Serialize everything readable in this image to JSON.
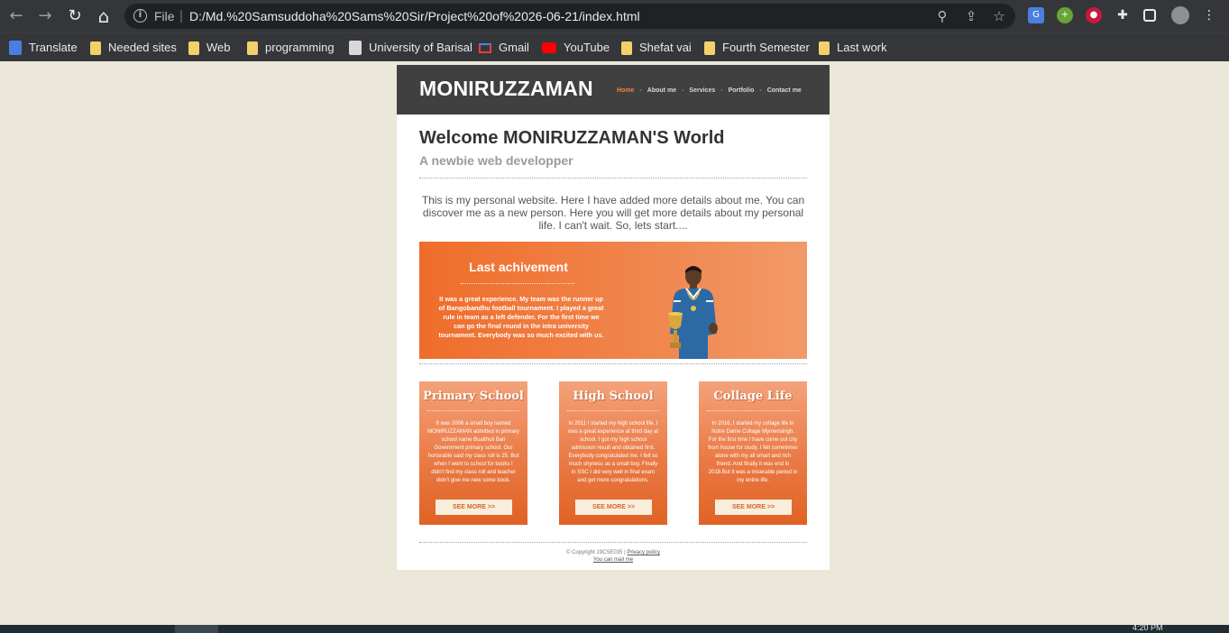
{
  "browser": {
    "nav": {
      "back": "←",
      "forward": "→",
      "reload": "↻",
      "home": "⌂"
    },
    "omnibox": {
      "scheme": "File",
      "separator": "|",
      "url": "D:/Md.%20Samsuddoha%20Sams%20Sir/Project%20of%2026-06-21/index.html"
    },
    "icons": [
      "zoom-icon",
      "share-icon",
      "bookmark-star-icon"
    ],
    "extensions": [
      "google-translate-extension-icon",
      "green-extension-icon",
      "red-extension-icon",
      "puzzle-extensions-icon",
      "side-panel-icon",
      "profile-avatar",
      "kebab-menu-icon"
    ],
    "bookmarks": [
      {
        "label": "Translate",
        "icon": "translate-icon"
      },
      {
        "label": "Needed sites",
        "icon": "folder-icon"
      },
      {
        "label": "Web",
        "icon": "folder-icon"
      },
      {
        "label": "programming",
        "icon": "folder-icon"
      },
      {
        "label": "University of Barisal",
        "icon": "university-icon"
      },
      {
        "label": "Gmail",
        "icon": "gmail-icon"
      },
      {
        "label": "YouTube",
        "icon": "youtube-icon"
      },
      {
        "label": "Shefat vai",
        "icon": "folder-icon"
      },
      {
        "label": "Fourth Semester",
        "icon": "folder-icon"
      },
      {
        "label": "Last work",
        "icon": "folder-icon"
      }
    ]
  },
  "site": {
    "logo": "MONIRUZZAMAN",
    "menu": [
      {
        "label": "Home",
        "active": true
      },
      {
        "label": "About me",
        "active": false
      },
      {
        "label": "Services",
        "active": false
      },
      {
        "label": "Portfolio",
        "active": false
      },
      {
        "label": "Contact me",
        "active": false
      }
    ],
    "menu_separator": "-",
    "welcome": "Welcome MONIRUZZAMAN'S World",
    "subtitle": "A newbie web developper",
    "intro": "This is my personal website. Here I have added more details about me. You can discover me as a new person. Here you will get more details about my personal life. I can't wait. So, lets start....",
    "banner": {
      "title": "Last achivement",
      "text": "It was a great experience. My team was the runner up of Bangobandhu football tournament. I played a great rule in team as a left defender. For the first time we can go the final round in the intra university tournament. Everybody was so much excited with us."
    },
    "cards": [
      {
        "title": "Primary School",
        "text": "It was 2006 a small boy named MONIRUZZAMAN admitted in primary school name Bualthuli Bari Government primary school. Our honorable said my class roll is 25. But when I went to school for books I didn't find my class roll and teacher didn't give me new some book.",
        "button": "SEE MORE >>"
      },
      {
        "title": "High School",
        "text": "In 2011 I started my high school life. I was a great experience at third day at school. I got my high school admission result and obtained first. Everybody congratulated me. I felt so much shyness as a small boy. Finally in SSC I did very well in final exam and get more congratulations.",
        "button": "SEE MORE >>"
      },
      {
        "title": "Collage Life",
        "text": "In 2016, I started my collage life in Notre Dame Collage Mymensingh. For the first time I have come out city from house for study. I felt sometimes alone with my all smart and rich friend. And finally it was end in 2018.But it was a miserable period in my entire life.",
        "button": "SEE MORE >>"
      }
    ],
    "footer": {
      "copyright": "© Copyright 19CSE035 | ",
      "privacy": "Privacy policy",
      "mail": "You can mail me"
    }
  },
  "taskbar": {
    "clock": "4:20 PM"
  }
}
